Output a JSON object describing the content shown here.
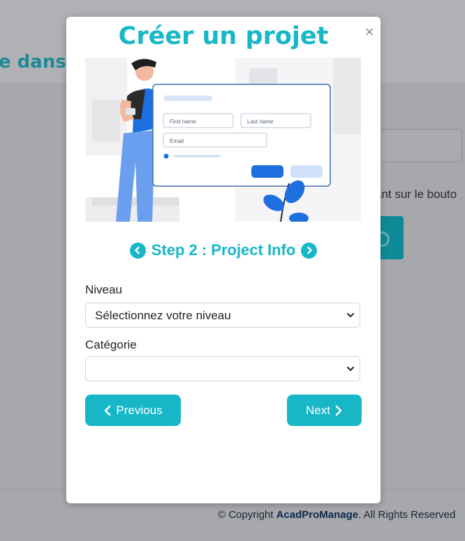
{
  "background": {
    "heading": "e dans v",
    "body_text": "ant sur le bouto",
    "footer": {
      "prefix": "© Copyright ",
      "brand": "AcadProManage",
      "suffix": ". All Rights Reserved"
    }
  },
  "modal": {
    "title": "Créer un projet",
    "close_label": "×",
    "illustration": {
      "first_name_placeholder": "First name",
      "last_name_placeholder": "Last name",
      "email_placeholder": "Email"
    },
    "step_title": "Step 2 : Project Info",
    "fields": {
      "niveau_label": "Niveau",
      "niveau_value": "Sélectionnez votre niveau",
      "categorie_label": "Catégorie",
      "categorie_value": ""
    },
    "buttons": {
      "previous_label": "Previous",
      "next_label": "Next"
    }
  },
  "colors": {
    "accent": "#17b7c8",
    "overlay": "#a7a8ac"
  },
  "icons": [
    "close-icon",
    "chevron-left-icon",
    "chevron-right-icon",
    "chevron-down-icon"
  ]
}
